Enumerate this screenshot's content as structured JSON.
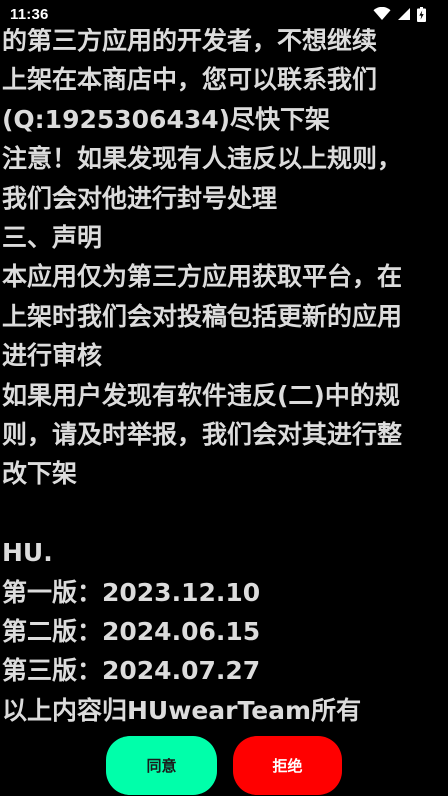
{
  "status_bar": {
    "time": "11:36",
    "icons": [
      "wifi-icon",
      "cellular-signal-icon",
      "battery-charging-icon"
    ]
  },
  "agreement": {
    "lines": [
      "的第三方应用的开发者，不想继续",
      "上架在本商店中，您可以联系我们",
      "(Q:1925306434)尽快下架",
      "注意！如果发现有人违反以上规则，",
      "我们会对他进行封号处理",
      "三、声明",
      "本应用仅为第三方应用获取平台，在",
      "上架时我们会对投稿包括更新的应用",
      "进行审核",
      "如果用户发现有软件违反(二)中的规",
      "则，请及时举报，我们会对其进行整",
      "改下架",
      "",
      "HU.",
      "第一版：2023.12.10",
      "第二版：2024.06.15",
      "第三版：2024.07.27",
      "以上内容归HUwearTeam所有"
    ]
  },
  "actions": {
    "agree_label": "同意",
    "reject_label": "拒绝"
  },
  "colors": {
    "background": "#000000",
    "text": "#dcdcdc",
    "agree_button": "#00ffaa",
    "reject_button": "#ff0000"
  }
}
